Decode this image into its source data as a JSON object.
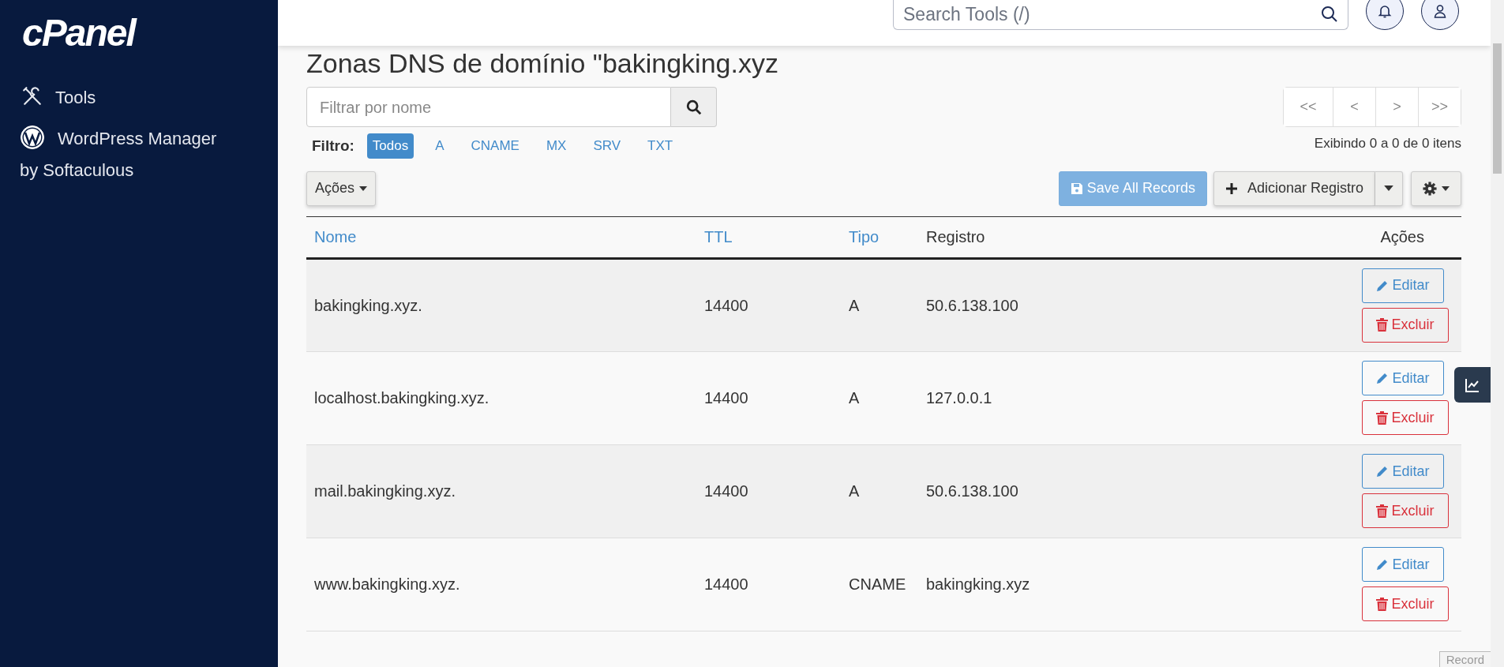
{
  "sidebar": {
    "logo": "cPanel",
    "items": [
      {
        "kind": "tools",
        "label": "Tools"
      },
      {
        "kind": "wordpress",
        "label": "WordPress Manager by Softaculous"
      }
    ]
  },
  "header": {
    "search": {
      "placeholder": "Search Tools (/)"
    }
  },
  "page": {
    "title": "Zonas DNS de domínio \"bakingking.xyz",
    "filter_field": {
      "placeholder": "Filtrar por nome"
    },
    "filter": {
      "label": "Filtro:",
      "options": [
        {
          "label": "Todos",
          "selected": true
        },
        {
          "label": "A",
          "selected": false
        },
        {
          "label": "CNAME",
          "selected": false
        },
        {
          "label": "MX",
          "selected": false
        },
        {
          "label": "SRV",
          "selected": false
        },
        {
          "label": "TXT",
          "selected": false
        }
      ]
    },
    "pagination": {
      "buttons": [
        "<<",
        "<",
        ">",
        ">>"
      ],
      "summary": "Exibindo 0 a 0 de 0 itens"
    },
    "toolbar": {
      "actions_menu": "Ações",
      "save": {
        "label": "Save All Records",
        "disabled": true
      },
      "add": "Adicionar Registro"
    },
    "table": {
      "columns": [
        {
          "label": "Nome",
          "sortable": true
        },
        {
          "label": "TTL",
          "sortable": true
        },
        {
          "label": "Tipo",
          "sortable": true
        },
        {
          "label": "Registro",
          "sortable": false
        },
        {
          "label": "Ações",
          "sortable": false
        }
      ],
      "rows": [
        {
          "name": "bakingking.xyz.",
          "ttl": "14400",
          "type": "A",
          "record": "50.6.138.100",
          "edit": "Editar",
          "delete": "Excluir"
        },
        {
          "name": "localhost.bakingking.xyz.",
          "ttl": "14400",
          "type": "A",
          "record": "127.0.0.1",
          "edit": "Editar",
          "delete": "Excluir"
        },
        {
          "name": "mail.bakingking.xyz.",
          "ttl": "14400",
          "type": "A",
          "record": "50.6.138.100",
          "edit": "Editar",
          "delete": "Excluir"
        },
        {
          "name": "www.bakingking.xyz.",
          "ttl": "14400",
          "type": "CNAME",
          "record": "bakingking.xyz",
          "edit": "Editar",
          "delete": "Excluir"
        }
      ]
    }
  },
  "corner_tab": {
    "label": "Record"
  }
}
